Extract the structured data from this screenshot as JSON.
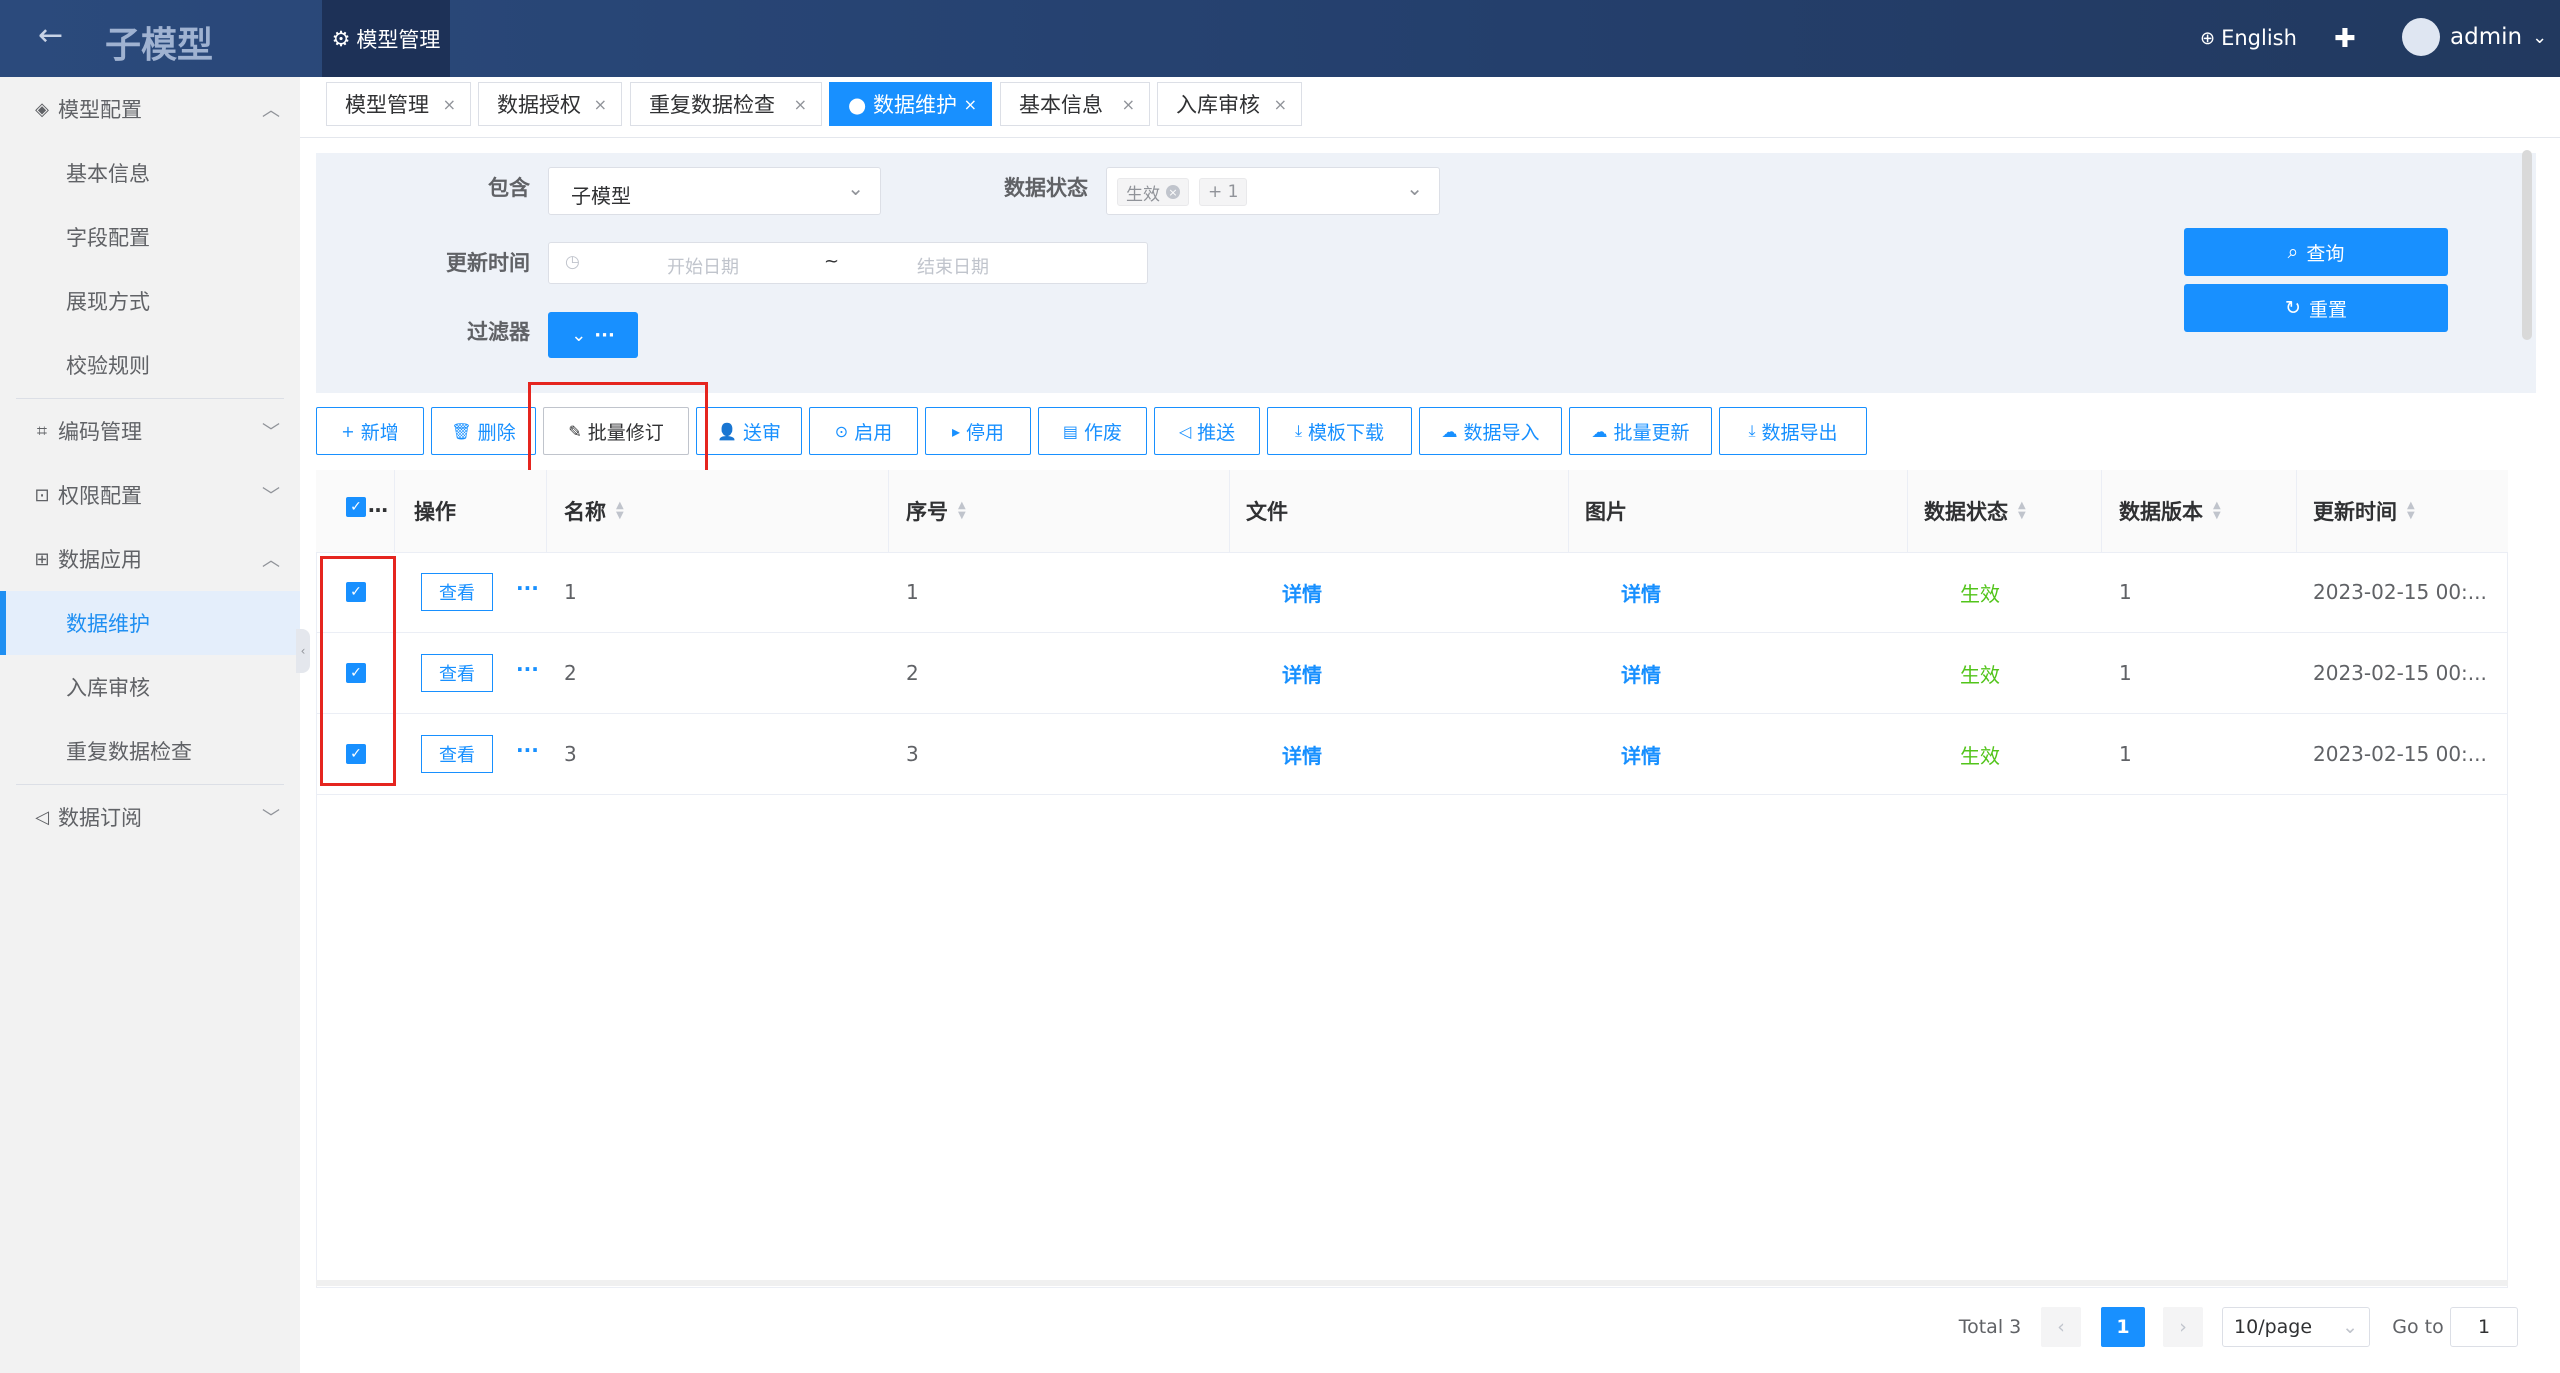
{
  "header": {
    "back_icon": "arrow-left-icon",
    "app_title": "子模型",
    "active_nav": "模型管理",
    "language": "English",
    "user": "admin"
  },
  "sidebar": {
    "groups": [
      {
        "label": "模型配置",
        "icon": "layers-icon",
        "expanded": true,
        "items": [
          "基本信息",
          "字段配置",
          "展现方式",
          "校验规则"
        ]
      },
      {
        "label": "编码管理",
        "icon": "code-icon",
        "expanded": false
      },
      {
        "label": "权限配置",
        "icon": "permission-icon",
        "expanded": false
      },
      {
        "label": "数据应用",
        "icon": "grid-icon",
        "expanded": true,
        "items": [
          "数据维护",
          "入库审核",
          "重复数据检查"
        ],
        "active": "数据维护"
      },
      {
        "label": "数据订阅",
        "icon": "send-icon",
        "expanded": false
      }
    ]
  },
  "tabs": [
    {
      "label": "模型管理",
      "active": false
    },
    {
      "label": "数据授权",
      "active": false
    },
    {
      "label": "重复数据检查",
      "active": false
    },
    {
      "label": "● 数据维护",
      "active": true
    },
    {
      "label": "基本信息",
      "active": false
    },
    {
      "label": "入库审核",
      "active": false
    }
  ],
  "filter": {
    "contains_label": "包含",
    "contains_value": "子模型",
    "status_label": "数据状态",
    "status_tag": "生效",
    "status_more": "+ 1",
    "update_label": "更新时间",
    "start_placeholder": "开始日期",
    "date_sep": "~",
    "end_placeholder": "结束日期",
    "filter_label": "过滤器",
    "filter_btn": "···",
    "query_btn": "查询",
    "reset_btn": "重置"
  },
  "toolbar": [
    "新增",
    "删除",
    "批量修订",
    "送审",
    "启用",
    "停用",
    "作废",
    "推送",
    "模板下载",
    "数据导入",
    "批量更新",
    "数据导出"
  ],
  "table": {
    "select_all": "…",
    "columns": [
      "操作",
      "名称",
      "序号",
      "文件",
      "图片",
      "数据状态",
      "数据版本",
      "更新时间"
    ],
    "view_btn": "查看",
    "more": "···",
    "rows": [
      {
        "name": "1",
        "seq": "1",
        "file": "详情",
        "image": "详情",
        "status": "生效",
        "version": "1",
        "updated": "2023-02-15 00:..."
      },
      {
        "name": "2",
        "seq": "2",
        "file": "详情",
        "image": "详情",
        "status": "生效",
        "version": "1",
        "updated": "2023-02-15 00:..."
      },
      {
        "name": "3",
        "seq": "3",
        "file": "详情",
        "image": "详情",
        "status": "生效",
        "version": "1",
        "updated": "2023-02-15 00:..."
      }
    ]
  },
  "pagination": {
    "total": "Total 3",
    "prev": "‹",
    "page": "1",
    "next": "›",
    "page_size": "10/page",
    "goto_label": "Go to",
    "goto_value": "1"
  },
  "colors": {
    "accent": "#1890ff",
    "header": "#243f6c",
    "status_green": "#52c41a",
    "highlight_red": "#e5251f"
  }
}
